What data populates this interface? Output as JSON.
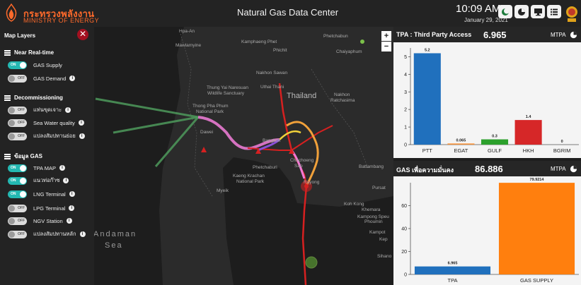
{
  "header": {
    "brand_th": "กระทรวงพลังงาน",
    "brand_en": "MINISTRY OF ENERGY",
    "title": "Natural Gas Data Center",
    "time": "10:09 AM",
    "date": "January 29, 2021",
    "buttons": [
      "moon-icon",
      "pie-chart-icon",
      "monitor-icon",
      "list-icon"
    ]
  },
  "map": {
    "places": {
      "hpa_an": "Hpa-An",
      "mawlamyine": "Mawlamyine",
      "kamphaeng": "Kamphaeng Phet",
      "phichit": "Phichit",
      "phetchabun": "Phetchabun",
      "nakhon_sawan": "Nakhon Sawan",
      "chaiyaphum": "Chaiyaphum",
      "uthai": "Uthai Thani",
      "thung_yai": "Thung Yai Naresuan",
      "wildlife": "Wildlife Sanctuary",
      "thailand": "Thailand",
      "nakhon_r": "Nakhon",
      "nakhon_r2": "Ratchasima",
      "thong_pha": "Thong Pha Phum",
      "np": "National Park",
      "dawei": "Dawei",
      "bangkok": "Bangkok",
      "chachoeng": "Chachoeng",
      "sao": "Sao",
      "phetchaburi": "Phetchaburi",
      "kaeng": "Kaeng Krachan",
      "np2": "National Park",
      "battambang": "Battambang",
      "pursat": "Pursat",
      "myeik": "Myeik",
      "rayong": "Rayong",
      "koh_kong": "Koh Kong",
      "kampong": "Kampong Speu",
      "kep": "Kep",
      "khemara": "Khemara",
      "phoumin": "Phoumin",
      "kampot": "Kampot",
      "sihanouk": "Sihano",
      "andaman": "Andaman",
      "sea": "Sea",
      "natural": "Natural Gas"
    },
    "zoom_in": "+",
    "zoom_out": "−"
  },
  "layers": {
    "title": "Map Layers",
    "close": "✕",
    "sections": [
      {
        "label": "Near Real-time",
        "items": [
          {
            "label": "GAS Supply",
            "state": "ON"
          },
          {
            "label": "GAS Demand",
            "state": "OFF"
          }
        ]
      },
      {
        "label": "Decommissioning",
        "items": [
          {
            "label": "แท่นขุดเจาะ",
            "state": "OFF"
          },
          {
            "label": "Sea Water quality",
            "state": "OFF"
          },
          {
            "label": "แปลงสัมปทานย่อย",
            "state": "OFF"
          }
        ]
      },
      {
        "label": "ข้อมูล GAS",
        "items": [
          {
            "label": "TPA MAP",
            "state": "ON"
          },
          {
            "label": "แนวท่อก๊าซ",
            "state": "ON"
          },
          {
            "label": "LNG Terminal",
            "state": "ON"
          },
          {
            "label": "LPG Terminal",
            "state": "OFF"
          },
          {
            "label": "NGV Station",
            "state": "OFF"
          },
          {
            "label": "แปลงสัมปทานหลัก",
            "state": "OFF"
          }
        ]
      }
    ]
  },
  "tpa_card": {
    "title": "TPA : Third Party Access",
    "value": "6.965",
    "unit": "MTPA",
    "chart_data": {
      "type": "bar",
      "categories": [
        "PTT",
        "EGAT",
        "GULF",
        "HKH",
        "BGRIM"
      ],
      "values": [
        5.2,
        0.065,
        0.3,
        1.4,
        0
      ],
      "value_labels": [
        "5.2",
        "0.065",
        "0.3",
        "1.4",
        "0"
      ],
      "colors": [
        "#2070bd",
        "#f7923a",
        "#2ca02c",
        "#d62728",
        "#9467bd"
      ],
      "ylim": [
        0,
        5.5
      ],
      "yticks": [
        0,
        1,
        2,
        3,
        4,
        5
      ]
    }
  },
  "gas_card": {
    "title": "GAS เพื่อความมั่นคง",
    "value": "86.886",
    "unit": "MTPA",
    "chart_data": {
      "type": "bar",
      "categories": [
        "TPA",
        "GAS SUPPLY"
      ],
      "values": [
        6.965,
        79.9214
      ],
      "value_labels": [
        "6.965",
        "79.9214"
      ],
      "colors": [
        "#2070bd",
        "#ff7f0e"
      ],
      "ylim": [
        0,
        80
      ],
      "yticks": [
        0,
        20,
        40,
        60
      ]
    }
  }
}
